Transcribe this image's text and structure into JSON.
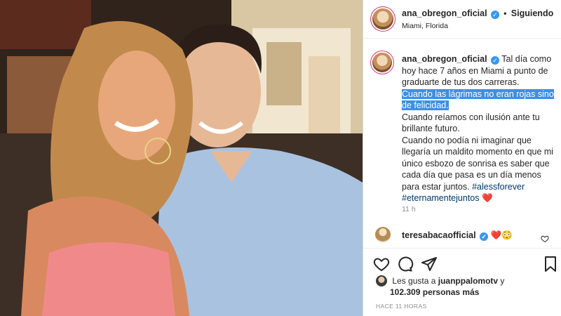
{
  "post": {
    "username": "ana_obregon_oficial",
    "verified_mark": "✓",
    "separator": "•",
    "follow_status": "Siguiendo",
    "location": "Miami, Florida",
    "caption": {
      "username": "ana_obregon_oficial",
      "text_1": "Tal día como hoy hace 7 años en Miami a punto de graduarte de tus dos carreras.",
      "text_highlighted": "Cuando las lágrimas no eran rojas sino de felicidad.",
      "text_2": "Cuando reíamos con ilusión ante tu brillante futuro.",
      "text_3": "Cuando no podía ni imaginar que llegaría un maldito momento en que mi único esbozo de sonrisa es saber que cada día que pasa es un día menos para estar juntos.",
      "hashtag_1": "#alessforever",
      "hashtag_2": "#eternamentejuntos",
      "heart": "❤️"
    },
    "time_ago": "11 h",
    "comment": {
      "username": "teresabacaofficial",
      "emojis": "❤️😳"
    },
    "likes": {
      "prefix": "Les gusta a",
      "user": "juanppalomotv",
      "and": "y",
      "count": "102.309",
      "suffix": "personas más"
    },
    "posted": "HACE 11 HORAS"
  },
  "icons": [
    "verified-icon",
    "heart-icon",
    "comment-icon",
    "share-icon",
    "bookmark-icon",
    "comment-like-icon"
  ],
  "colors": {
    "highlight": "#3b8fe6",
    "link": "#00376b",
    "verified": "#3897f0",
    "muted": "#8e8e8e"
  }
}
